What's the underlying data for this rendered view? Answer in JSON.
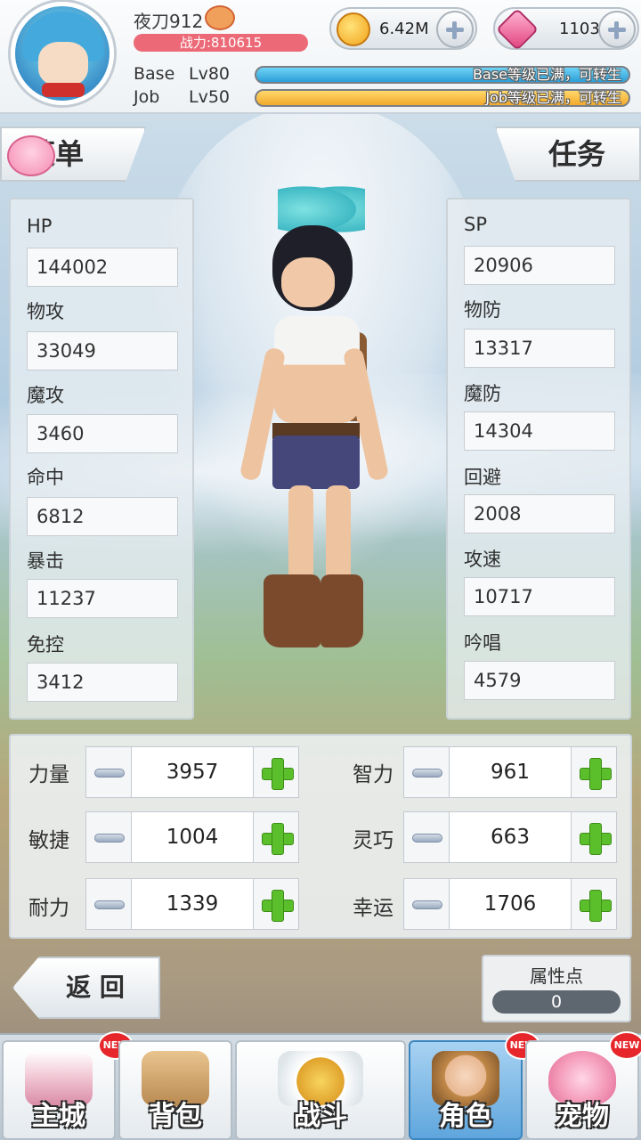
{
  "player": {
    "name": "夜刀912",
    "power": "战力:810615",
    "base_label": "Base",
    "base_level": "Lv80",
    "base_status": "Base等级已满，可转生",
    "job_label": "Job",
    "job_level": "Lv50",
    "job_status": "Job等级已满，可转生"
  },
  "currency": {
    "gold": "6.42M",
    "gems": "1103"
  },
  "tabs": {
    "left": "菜单",
    "right": "任务"
  },
  "stats_left": [
    {
      "label": "HP",
      "value": "144002"
    },
    {
      "label": "物攻",
      "value": "33049"
    },
    {
      "label": "魔攻",
      "value": "3460"
    },
    {
      "label": "命中",
      "value": "6812"
    },
    {
      "label": "暴击",
      "value": "11237"
    },
    {
      "label": "免控",
      "value": "3412"
    }
  ],
  "stats_right": [
    {
      "label": "SP",
      "value": "20906"
    },
    {
      "label": "物防",
      "value": "13317"
    },
    {
      "label": "魔防",
      "value": "14304"
    },
    {
      "label": "回避",
      "value": "2008"
    },
    {
      "label": "攻速",
      "value": "10717"
    },
    {
      "label": "吟唱",
      "value": "4579"
    }
  ],
  "attributes": [
    {
      "label": "力量",
      "value": "3957"
    },
    {
      "label": "智力",
      "value": "961"
    },
    {
      "label": "敏捷",
      "value": "1004"
    },
    {
      "label": "灵巧",
      "value": "663"
    },
    {
      "label": "耐力",
      "value": "1339"
    },
    {
      "label": "幸运",
      "value": "1706"
    }
  ],
  "back_label": "返 回",
  "points": {
    "label": "属性点",
    "value": "0"
  },
  "nav": [
    {
      "label": "主城",
      "badge": "NEW",
      "icon": "castle-icon"
    },
    {
      "label": "背包",
      "badge": "",
      "icon": "backpack-icon"
    },
    {
      "label": "战斗",
      "badge": "",
      "icon": "battle-icon"
    },
    {
      "label": "角色",
      "badge": "NEW",
      "icon": "character-icon",
      "active": true
    },
    {
      "label": "宠物",
      "badge": "NEW",
      "icon": "pet-icon"
    }
  ],
  "colors": {
    "power_bar": "#ec6a77",
    "base_bar": "#2d9fd8",
    "job_bar": "#f2a92b",
    "plus_green": "#5bbf2b",
    "nav_active": "#5fa6dd",
    "badge_red": "#e6262b"
  }
}
